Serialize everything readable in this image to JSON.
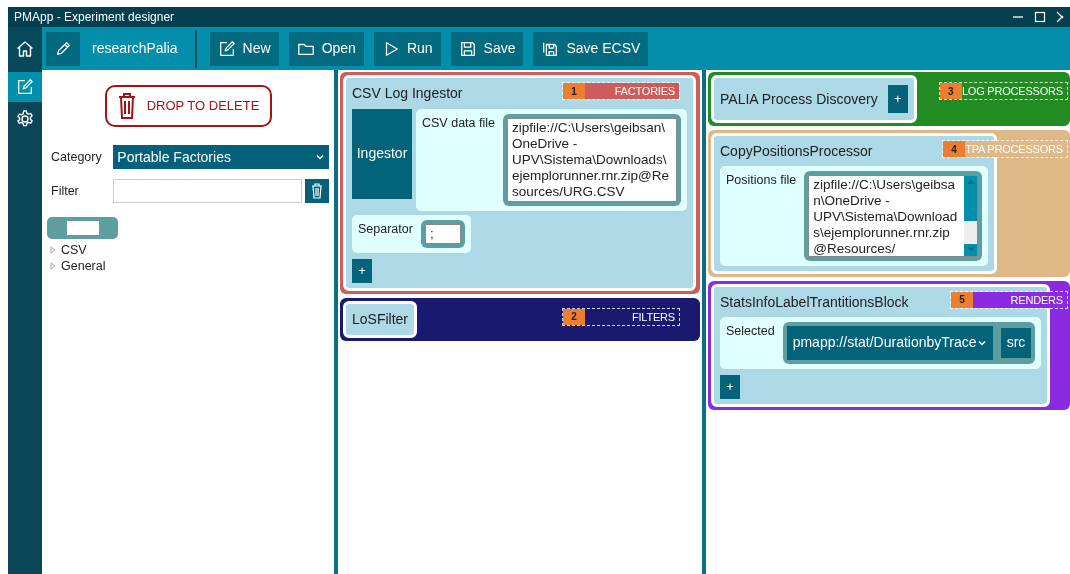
{
  "window": {
    "title": "PMApp  -  Experiment designer"
  },
  "rail": {
    "items": [
      {
        "selected": false
      },
      {
        "selected": true
      },
      {
        "selected": false
      }
    ]
  },
  "toolbar": {
    "project": "researchPalia",
    "buttons": [
      {
        "label": "New"
      },
      {
        "label": "Open"
      },
      {
        "label": "Run"
      },
      {
        "label": "Save"
      },
      {
        "label": "Save ECSV"
      }
    ]
  },
  "sidebar": {
    "drop_zone": "DROP TO DELETE",
    "category": {
      "label": "Category",
      "value": "Portable Factories"
    },
    "filter": {
      "label": "Filter"
    },
    "tree": [
      {
        "label": "CSV",
        "expanded": false
      },
      {
        "label": "General",
        "expanded": false
      }
    ]
  },
  "columns": [
    {
      "sections": [
        {
          "number": "1",
          "label": "FACTORIES",
          "color": "#cd5c5c",
          "blocks": [
            {
              "title": "CSV Log Ingestor",
              "role": "Ingestor",
              "params": [
                {
                  "kind": "textarea",
                  "label": "CSV data file",
                  "value": "zipfile://C:\\Users\\geibsan\\OneDrive - UPV\\Sistema\\Downloads\\ejemplorunner.rnr.zip@Resources/URG.CSV"
                },
                {
                  "kind": "input",
                  "label": "Separator",
                  "value": ";"
                }
              ],
              "add": "+",
              "add_inline": false
            }
          ]
        },
        {
          "number": "2",
          "label": "FILTERS",
          "color": "#191970",
          "blocks": [
            {
              "title": "LoSFilter"
            }
          ]
        }
      ]
    },
    {
      "sections": [
        {
          "number": "3",
          "label": "LOG PROCESSORS",
          "color": "#228b22",
          "blocks": [
            {
              "title": "PALIA Process Discovery",
              "add": "+",
              "add_inline": true
            }
          ]
        },
        {
          "number": "4",
          "label": "TPA PROCESSORS",
          "color": "#deb887",
          "blocks": [
            {
              "title": "CopyPositionsProcessor",
              "params": [
                {
                  "kind": "scroll_text",
                  "label": "Positions file",
                  "value": "zipfile://C:\\Users\\geibsan\\OneDrive - UPV\\Sistema\\Downloads\\ejemplorunner.rnr.zip@Resources/"
                }
              ]
            }
          ]
        },
        {
          "number": "5",
          "label": "RENDERS",
          "color": "#8a2be2",
          "blocks": [
            {
              "title": "StatsInfoLabelTrantitionsBlock",
              "params": [
                {
                  "kind": "select",
                  "label": "Selected",
                  "value": "pmapp://stat/DurationbyTrace",
                  "button": "src"
                }
              ],
              "add": "+",
              "add_inline": false
            }
          ]
        }
      ]
    }
  ]
}
